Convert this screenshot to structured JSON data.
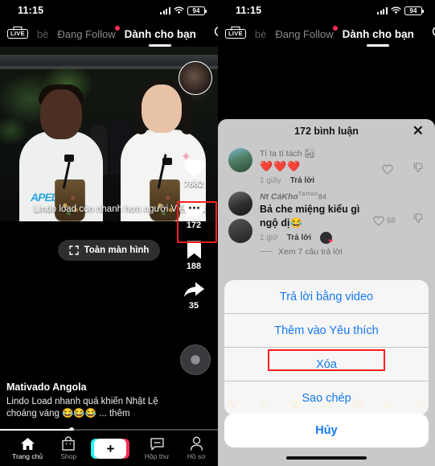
{
  "status_bar": {
    "time": "11:15",
    "battery": "94",
    "signal_icon": "cellular-bars-icon",
    "wifi_icon": "wifi-icon"
  },
  "top_nav": {
    "live_label": "LIVE",
    "friends_label": "bè",
    "following_label": "Đang Follow",
    "foryou_label": "Dành cho bạn",
    "search_icon": "search-icon"
  },
  "left_phone": {
    "video": {
      "overlay_caption": "Lindo load còn nhanh hơn người Việt nữa",
      "fullscreen_label": "Toàn màn hình",
      "username": "Mativado Angola",
      "description": "Lindo Load nhanh quá khiến Nhật Lệ choáng váng 😂😂😂 ... thêm",
      "likes": "7682",
      "comments": "172",
      "bookmarks": "188",
      "shares": "35",
      "progress_percent": 33
    },
    "tabbar": [
      {
        "label": "Trang chủ",
        "icon": "home-icon"
      },
      {
        "label": "Shop",
        "icon": "shop-bag-icon"
      },
      {
        "label": "",
        "icon": "create-plus-icon"
      },
      {
        "label": "Hộp thư",
        "icon": "inbox-icon"
      },
      {
        "label": "Hồ sơ",
        "icon": "profile-person-icon"
      }
    ]
  },
  "right_phone": {
    "comments_sheet": {
      "title": "172 bình luận",
      "close_icon": "close-icon",
      "comments": [
        {
          "username": "Tí ta tí tách 🏜",
          "text": "❤️❤️❤️",
          "time": "1 giây",
          "reply_label": "Trả lời",
          "like_count": "",
          "like_icon": "heart-outline-icon",
          "dislike_icon": "thumbs-down-icon"
        },
        {
          "username_main": "Nt CáKho",
          "username_tattoo": "Tattoo",
          "username_num": "84",
          "text": "Bả che miệng kiểu gì ngộ dị😂",
          "time": "1 giờ",
          "reply_label": "Trả lời",
          "like_count": "68",
          "like_icon": "heart-outline-icon",
          "dislike_icon": "thumbs-down-icon",
          "view_replies_label": "Xem 7 câu trả lời"
        }
      ],
      "emoji_row": [
        "😍",
        "😂",
        "😮",
        "😢",
        "😡",
        "👍",
        "👏"
      ]
    },
    "action_sheet": {
      "options": [
        {
          "label": "Trả lời bằng video",
          "highlighted": false
        },
        {
          "label": "Thêm vào Yêu thích",
          "highlighted": false
        },
        {
          "label": "Xóa",
          "highlighted": true
        },
        {
          "label": "Sao chép",
          "highlighted": false
        }
      ],
      "cancel_label": "Hủy",
      "highlight_color": "#ff1f1f"
    }
  }
}
